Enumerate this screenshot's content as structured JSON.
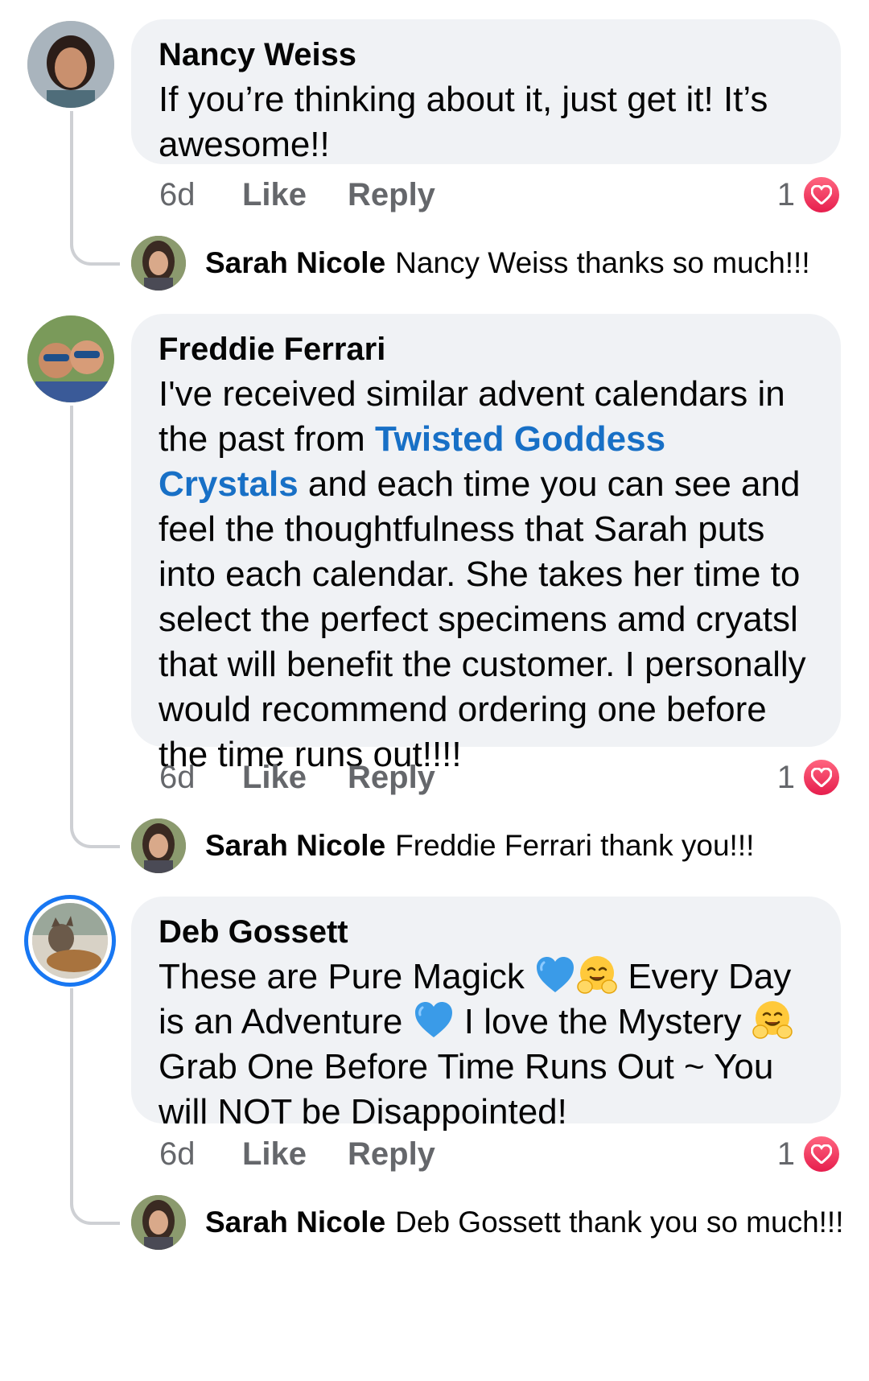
{
  "comments": [
    {
      "author": "Nancy Weiss",
      "text": "If you’re thinking about it, just get it! It’s awesome!!",
      "time": "6d",
      "like_label": "Like",
      "reply_label": "Reply",
      "reaction_count": "1",
      "reaction_icon": "heart-icon",
      "reply": {
        "author": "Sarah Nicole",
        "text": "Nancy Weiss thanks so much!!!"
      }
    },
    {
      "author": "Freddie Ferrari",
      "text_parts": [
        "I've received similar advent calendars in the past from ",
        "Twisted Goddess Crystals",
        " and each time you can see and feel the thoughtfulness that Sarah puts into each calendar. She takes her time to select the perfect specimens amd cryatsl that will benefit the customer. I personally would recommend ordering one before the time runs out!!!!"
      ],
      "time": "6d",
      "like_label": "Like",
      "reply_label": "Reply",
      "reaction_count": "1",
      "reaction_icon": "heart-icon",
      "reply": {
        "author": "Sarah Nicole",
        "text": "Freddie Ferrari thank you!!!"
      }
    },
    {
      "author": "Deb Gossett",
      "text_parts": [
        "These are Pure Magick ",
        " Every Day is an Adventure ",
        " I love the Mystery ",
        " Grab One Before Time Runs Out ~ You will NOT be Disappointed!"
      ],
      "emojis": [
        "blue-heart-emoji",
        "hugging-face-emoji",
        "blue-heart-emoji",
        "hugging-face-emoji"
      ],
      "time": "6d",
      "like_label": "Like",
      "reply_label": "Reply",
      "reaction_count": "1",
      "reaction_icon": "heart-icon",
      "reply": {
        "author": "Sarah Nicole",
        "text": "Deb Gossett thank you so much!!!"
      }
    }
  ],
  "colors": {
    "bubble": "#f0f2f5",
    "link": "#1870c6",
    "meta": "#65676b",
    "story_ring": "#1877f2",
    "heart_reaction": "#e61e4d"
  }
}
